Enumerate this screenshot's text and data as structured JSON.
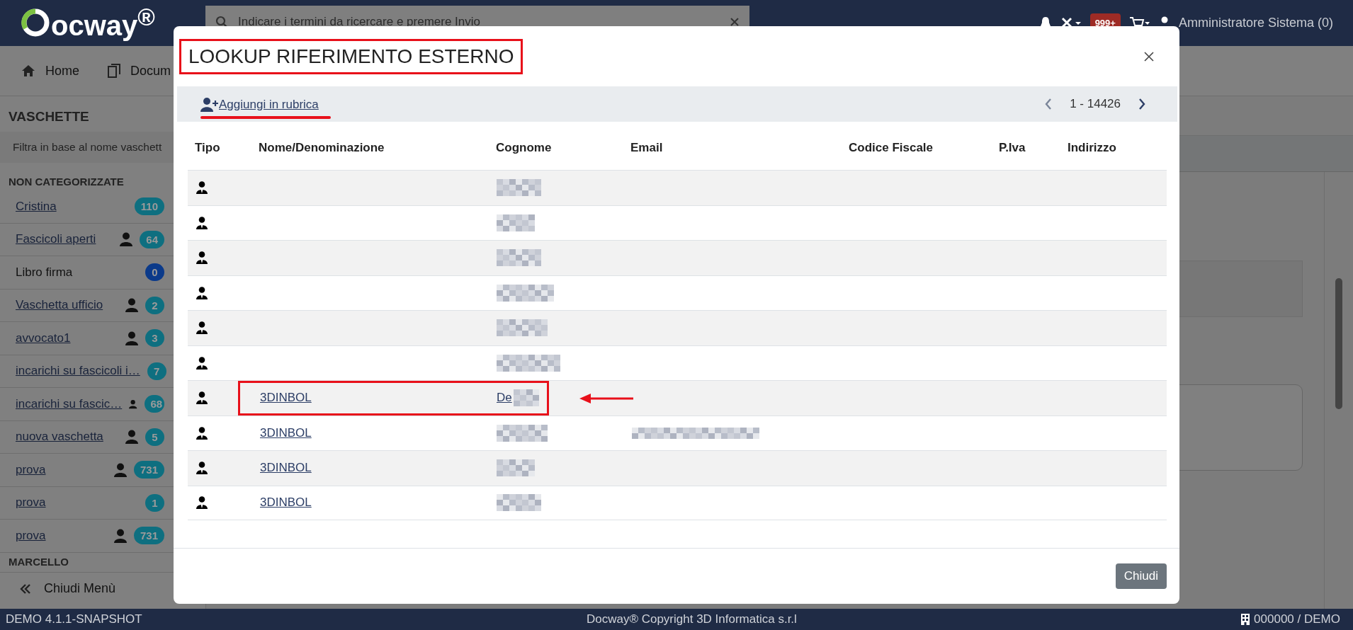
{
  "header": {
    "logo": "ocway$^{®}$",
    "search": {
      "placeholder": "Indicare i termini da ricercare e premere Invio"
    },
    "badge": "999+",
    "user": "Amministratore Sistema (0)"
  },
  "nav": [
    {
      "label": "Home",
      "kind": "home"
    },
    {
      "label": "Docum",
      "kind": "documents"
    }
  ],
  "sidebar": {
    "title": "VASCHETTE",
    "filter": {
      "placeholder": "Filtra in base al nome vaschett"
    },
    "groups": [
      {
        "label": "NON CATEGORIZZATE",
        "items": [
          {
            "name": "Cristina",
            "link": true,
            "personal": false,
            "count": "110",
            "color": "#0e6f80"
          },
          {
            "name": "Fascicoli aperti",
            "link": true,
            "personal": true,
            "count": "64",
            "color": "#0e6f80"
          },
          {
            "name": "Libro firma",
            "link": false,
            "personal": false,
            "count": "0",
            "color": "#0b3a8a"
          },
          {
            "name": "Vaschetta ufficio",
            "link": true,
            "personal": true,
            "count": "2",
            "color": "#0e6f80"
          },
          {
            "name": "avvocato1",
            "link": true,
            "personal": true,
            "count": "3",
            "color": "#0e6f80"
          },
          {
            "name": "incarichi su fascicoli i…",
            "link": true,
            "personal": false,
            "count": "7",
            "color": "#0e6f80"
          },
          {
            "name": "incarichi su fascic…",
            "link": true,
            "personal": true,
            "count": "68",
            "color": "#0e6f80"
          },
          {
            "name": "nuova vaschetta",
            "link": true,
            "personal": true,
            "count": "5",
            "color": "#0e6f80"
          },
          {
            "name": "prova",
            "link": true,
            "personal": true,
            "count": "731",
            "color": "#0e6f80"
          },
          {
            "name": "prova",
            "link": true,
            "personal": false,
            "count": "1",
            "color": "#0e6f80"
          },
          {
            "name": "prova",
            "link": true,
            "personal": true,
            "count": "731",
            "color": "#0e6f80"
          }
        ]
      },
      {
        "label": "MARCELLO"
      }
    ],
    "close_menu": "Chiudi Menù"
  },
  "status_bar": {
    "version": "DEMO 4.1.1-SNAPSHOT",
    "copyright": "Docway® Copyright 3D Informatica s.r.l",
    "office": "000000 / DEMO"
  },
  "dialog": {
    "title": "LOOKUP RIFERIMENTO ESTERNO",
    "title_highlighted": true,
    "add_link": {
      "label": "Aggiungi in rubrica",
      "highlighted": true
    },
    "range": "1 - 14426",
    "columns": [
      "Tipo",
      "Nome/Denominazione",
      "Cognome",
      "Email",
      "Codice Fiscale",
      "P.Iva",
      "Indirizzo"
    ],
    "rows": [
      {
        "surname_redacted": true,
        "email_redacted": false,
        "highlighted": false
      },
      {
        "surname_redacted": true,
        "email_redacted": false,
        "highlighted": false
      },
      {
        "surname_redacted": true,
        "email_redacted": false,
        "highlighted": false
      },
      {
        "surname_redacted": true,
        "email_redacted": false,
        "highlighted": false
      },
      {
        "surname_redacted": true,
        "email_redacted": false,
        "highlighted": false
      },
      {
        "surname_redacted": true,
        "email_redacted": false,
        "highlighted": false
      },
      {
        "name": "3DINBOL",
        "surname": "De",
        "surname_redacted": true,
        "email_redacted": false,
        "highlighted": true
      },
      {
        "name": "3DINBOL",
        "surname_redacted": true,
        "email_redacted": true,
        "highlighted": false
      },
      {
        "name": "3DINBOL",
        "surname_redacted": true,
        "email_redacted": false,
        "highlighted": false
      },
      {
        "name": "3DINBOL",
        "surname_redacted": true,
        "email_redacted": false,
        "highlighted": false
      }
    ],
    "buttons": [
      "Chiudi"
    ]
  }
}
